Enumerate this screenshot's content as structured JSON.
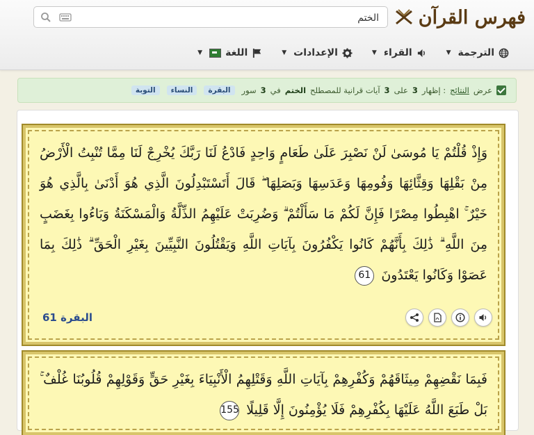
{
  "header": {
    "brand": "فهرس القرآن",
    "search": {
      "value": "الختم",
      "placeholder": ""
    },
    "nav": {
      "translation": "الترجمة",
      "readers": "القراء",
      "settings": "الإعدادات",
      "language": "اللغة"
    }
  },
  "results": {
    "prefix": "عرض",
    "link": "النتائج",
    "text_a": ": إظهار",
    "shown": "3",
    "text_b": "على",
    "total": "3",
    "text_c": "آيات قرانية للمصطلح",
    "term": "الختم",
    "text_d": "في",
    "suras_count": "3",
    "text_e": "سور",
    "badges": [
      "البقرة",
      "النساء",
      "التوبة"
    ]
  },
  "verses": [
    {
      "text": "وَإِذْ قُلْتُمْ يَا مُوسَىٰ لَنْ نَصْبِرَ عَلَىٰ طَعَامٍ وَاحِدٍ فَادْعُ لَنَا رَبَّكَ يُخْرِجْ لَنَا مِمَّا تُنْبِتُ الْأَرْضُ مِنْ بَقْلِهَا وَقِثَّائِهَا وَفُومِهَا وَعَدَسِهَا وَبَصَلِهَا ۖ قَالَ أَتَسْتَبْدِلُونَ الَّذِي هُوَ أَدْنَىٰ بِالَّذِي هُوَ خَيْرٌ ۚ اهْبِطُوا مِصْرًا فَإِنَّ لَكُمْ مَا سَأَلْتُمْ ۗ وَضُرِبَتْ عَلَيْهِمُ الذِّلَّةُ وَالْمَسْكَنَةُ وَبَاءُوا بِغَضَبٍ مِنَ اللَّهِ ۗ ذَٰلِكَ بِأَنَّهُمْ كَانُوا يَكْفُرُونَ بِآيَاتِ اللَّهِ وَيَقْتُلُونَ النَّبِيِّينَ بِغَيْرِ الْحَقِّ ۗ ذَٰلِكَ بِمَا عَصَوْا وَكَانُوا يَعْتَدُونَ",
      "number": "61",
      "ref": "البقرة 61"
    },
    {
      "text": "فَبِمَا نَقْضِهِمْ مِيثَاقَهُمْ وَكُفْرِهِمْ بِآيَاتِ اللَّهِ وَقَتْلِهِمُ الْأَنْبِيَاءَ بِغَيْرِ حَقٍّ وَقَوْلِهِمْ قُلُوبُنَا غُلْفٌ ۚ بَلْ طَبَعَ اللَّهُ عَلَيْهَا بِكُفْرِهِمْ فَلَا يُؤْمِنُونَ إِلَّا قَلِيلًا",
      "number": "155"
    }
  ],
  "colors": {
    "brand": "#5a3b14",
    "card_bg": "#fdf8b5",
    "card_border": "#d8c56a",
    "ref": "#2c4d8e",
    "success_bg": "#dff0d8"
  },
  "icons": [
    "logo-icon",
    "search-icon",
    "keyboard-icon",
    "globe-icon",
    "speaker-icon",
    "gear-icon",
    "flag-icon",
    "check-icon",
    "share-icon",
    "pdf-icon",
    "info-icon",
    "audio-icon"
  ]
}
